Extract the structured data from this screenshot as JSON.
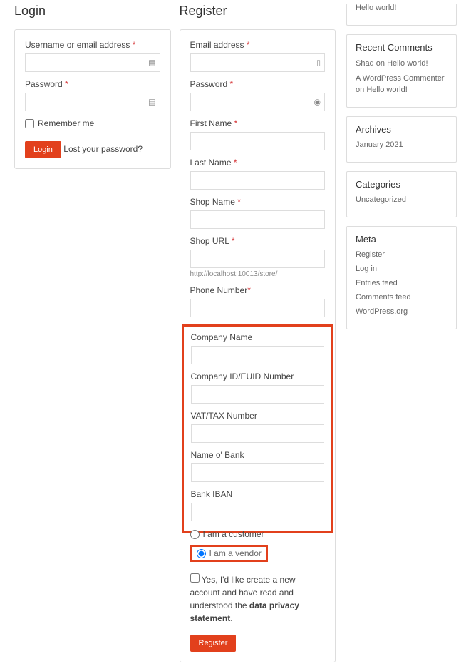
{
  "login": {
    "heading": "Login",
    "username_label": "Username or email address",
    "password_label": "Password",
    "remember_label": "Remember me",
    "button": "Login",
    "lost_link": "Lost your password?"
  },
  "register": {
    "heading": "Register",
    "email_label": "Email address",
    "password_label": "Password",
    "firstname_label": "First Name",
    "lastname_label": "Last Name",
    "shopname_label": "Shop Name",
    "shopurl_label": "Shop URL",
    "shopurl_hint": "http://localhost:10013/store/",
    "phone_label": "Phone Number",
    "company_name_label": "Company Name",
    "company_id_label": "Company ID/EUID Number",
    "vat_label": "VAT/TAX Number",
    "bank_name_label": "Name o' Bank",
    "iban_label": "Bank IBAN",
    "customer_label": "I am a customer",
    "vendor_label": "I am a vendor",
    "consent_text": "Yes, I'd like create a new account and have read and understood the ",
    "consent_link": "data privacy statement",
    "button": "Register"
  },
  "sidebar": {
    "recent_posts": {
      "items": [
        "Hello world!"
      ]
    },
    "recent_comments": {
      "heading": "Recent Comments",
      "items": [
        {
          "author": "Shad",
          "on": "on",
          "post": "Hello world!"
        },
        {
          "author": "A WordPress Commenter",
          "on": "on",
          "post": "Hello world!"
        }
      ]
    },
    "archives": {
      "heading": "Archives",
      "items": [
        "January 2021"
      ]
    },
    "categories": {
      "heading": "Categories",
      "items": [
        "Uncategorized"
      ]
    },
    "meta": {
      "heading": "Meta",
      "items": [
        "Register",
        "Log in",
        "Entries feed",
        "Comments feed",
        "WordPress.org"
      ]
    }
  }
}
